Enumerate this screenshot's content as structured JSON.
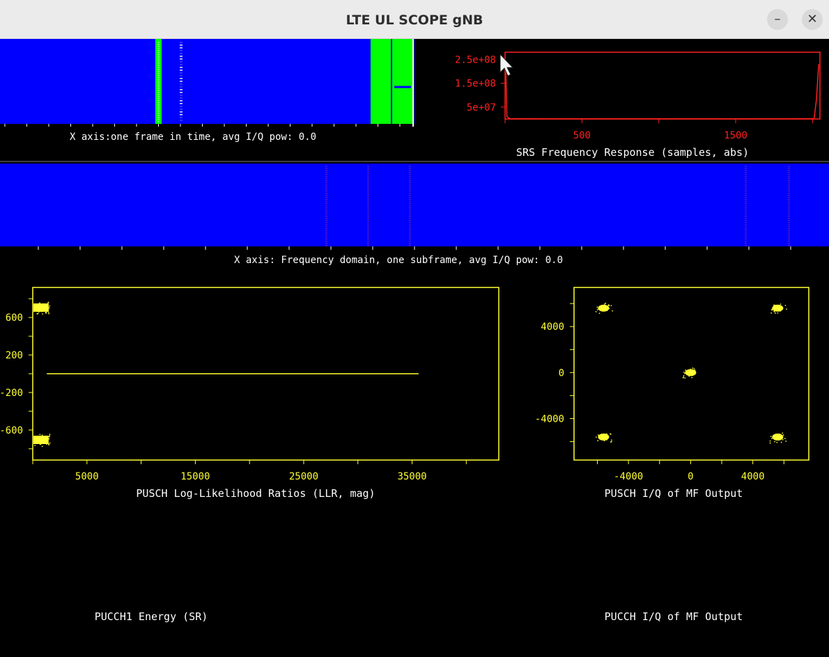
{
  "window": {
    "title": "LTE UL SCOPE gNB",
    "minimize_glyph": "–",
    "close_glyph": "✕"
  },
  "panels": {
    "time_domain": {
      "xlabel": "X axis:one frame in time, avg I/Q pow:  0.0",
      "colors": {
        "background": "#0000ff",
        "signal": "#00ff00",
        "tick": "#ffffff"
      }
    },
    "freq_domain": {
      "xlabel": "X axis: Frequency domain, one subframe, avg I/Q pow:  0.0",
      "colors": {
        "background": "#0000ff",
        "marker": "#ff4040"
      }
    }
  },
  "icons": {
    "cursor": "mouse-pointer-icon"
  },
  "chart_data": [
    {
      "id": "srs",
      "type": "line",
      "title": "SRS Frequency Response (samples, abs)",
      "xlim": [
        0,
        2048
      ],
      "ylim": [
        0,
        280000000.0
      ],
      "xticks": [
        500,
        1500
      ],
      "yticks": [
        250000000,
        150000000,
        50000000
      ],
      "ytick_labels": [
        "2.5e+08",
        "1.5e+08",
        "5e+07"
      ],
      "color": "#ff2020",
      "points": [
        [
          0,
          250000000.0
        ],
        [
          5,
          200000000.0
        ],
        [
          12,
          10000000.0
        ],
        [
          30,
          2000000.0
        ],
        [
          300,
          1000000.0
        ],
        [
          1000,
          1000000.0
        ],
        [
          1800,
          1000000.0
        ],
        [
          2010,
          2000000.0
        ],
        [
          2025,
          80000000.0
        ],
        [
          2035,
          180000000.0
        ],
        [
          2040,
          230000000.0
        ]
      ]
    },
    {
      "id": "llr",
      "type": "scatter",
      "title": "PUSCH Log-Likelihood Ratios (LLR, mag)",
      "xlim": [
        0,
        43000
      ],
      "ylim": [
        -920,
        920
      ],
      "xticks": [
        5000,
        15000,
        25000,
        35000
      ],
      "yticks": [
        600,
        200,
        -200,
        -600
      ],
      "ytick_labels": [
        "600",
        "200",
        "-200",
        "-600"
      ],
      "color": "#ffff33",
      "clusters": [
        {
          "x": [
            0,
            1400
          ],
          "y": 705
        },
        {
          "x": [
            0,
            1400
          ],
          "y": -705
        }
      ],
      "line": {
        "x": [
          1300,
          35600
        ],
        "y": 0
      }
    },
    {
      "id": "pusch_iq",
      "type": "scatter",
      "title": "PUSCH I/Q of MF Output",
      "xlim": [
        -7500,
        7600
      ],
      "ylim": [
        -7600,
        7400
      ],
      "xticks": [
        -4000,
        0,
        4000
      ],
      "yticks": [
        4000,
        0,
        -4000
      ],
      "ytick_labels": [
        "4000",
        "0",
        "-4000"
      ],
      "color": "#ffff33",
      "points": [
        [
          -5600,
          5600
        ],
        [
          5600,
          5600
        ],
        [
          0,
          0
        ],
        [
          -5600,
          -5600
        ],
        [
          5600,
          -5600
        ]
      ]
    },
    {
      "id": "pucch_energy",
      "type": "line",
      "title": "PUCCH1 Energy (SR)"
    },
    {
      "id": "pucch_iq",
      "type": "scatter",
      "title": "PUCCH I/Q of MF Output"
    }
  ]
}
